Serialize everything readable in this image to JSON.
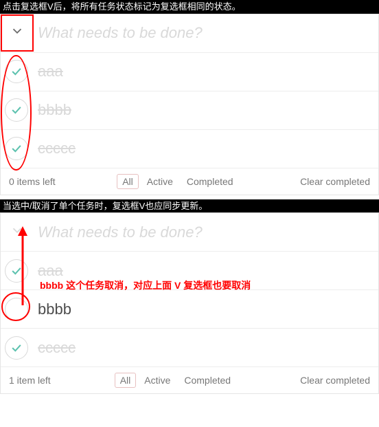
{
  "captions": {
    "top": "点击复选框V后，将所有任务状态标记为复选框相同的状态。",
    "bottom": "当选中/取消了单个任务时，复选框V也应同步更新。"
  },
  "placeholder": "What needs to be done?",
  "filters": {
    "all": "All",
    "active": "Active",
    "completed": "Completed"
  },
  "clear_label": "Clear completed",
  "app1": {
    "items_left": "0 items left",
    "todos": [
      {
        "label": "aaa",
        "done": true
      },
      {
        "label": "bbbb",
        "done": true
      },
      {
        "label": "ccccc",
        "done": true
      }
    ]
  },
  "app2": {
    "items_left": "1 item left",
    "red_note": "bbbb 这个任务取消，对应上面 V 复选框也要取消",
    "todos": [
      {
        "label": "aaa",
        "done": true
      },
      {
        "label": "bbbb",
        "done": false
      },
      {
        "label": "ccccc",
        "done": true
      }
    ]
  }
}
